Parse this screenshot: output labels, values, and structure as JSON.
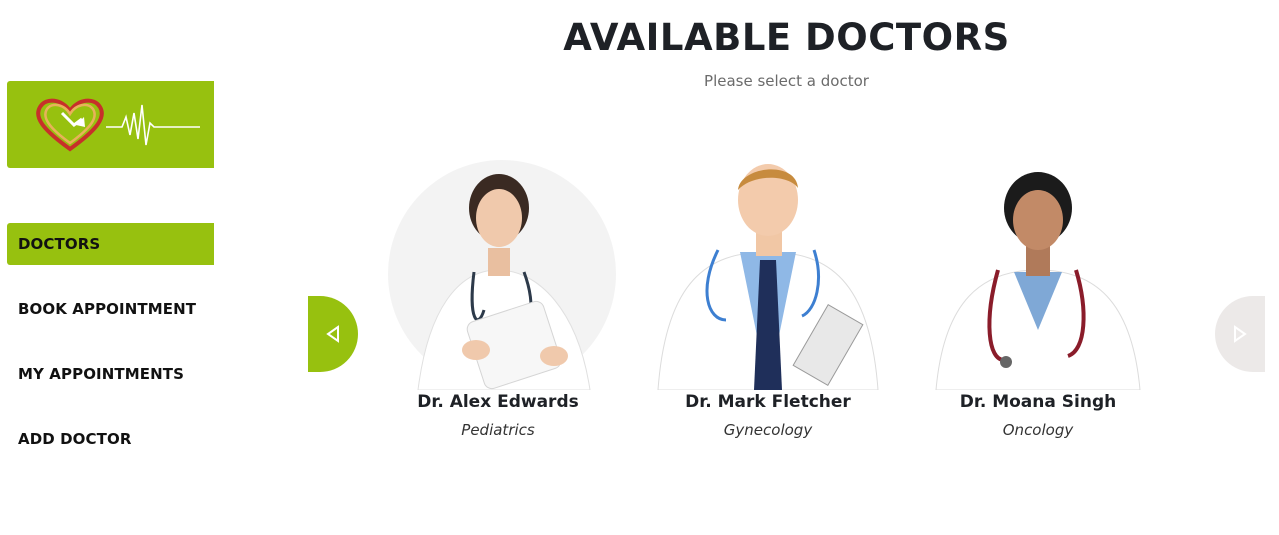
{
  "header": {
    "title": "AVAILABLE DOCTORS",
    "subtitle": "Please select a doctor"
  },
  "sidebar": {
    "logo_icon": "heart-pulse-logo",
    "items": [
      {
        "label": "DOCTORS",
        "active": true
      },
      {
        "label": "BOOK APPOINTMENT",
        "active": false
      },
      {
        "label": "MY APPOINTMENTS",
        "active": false
      },
      {
        "label": "ADD DOCTOR",
        "active": false
      }
    ]
  },
  "carousel": {
    "prev_icon": "chevron-left-icon",
    "next_icon": "chevron-right-icon",
    "doctors": [
      {
        "name": "Dr. Alex Edwards",
        "specialty": "Pediatrics"
      },
      {
        "name": "Dr. Mark Fletcher",
        "specialty": "Gynecology"
      },
      {
        "name": "Dr. Moana Singh",
        "specialty": "Oncology"
      }
    ]
  },
  "colors": {
    "accent": "#97c10f",
    "text": "#1e2126",
    "muted_arrow": "#ece9e8"
  }
}
